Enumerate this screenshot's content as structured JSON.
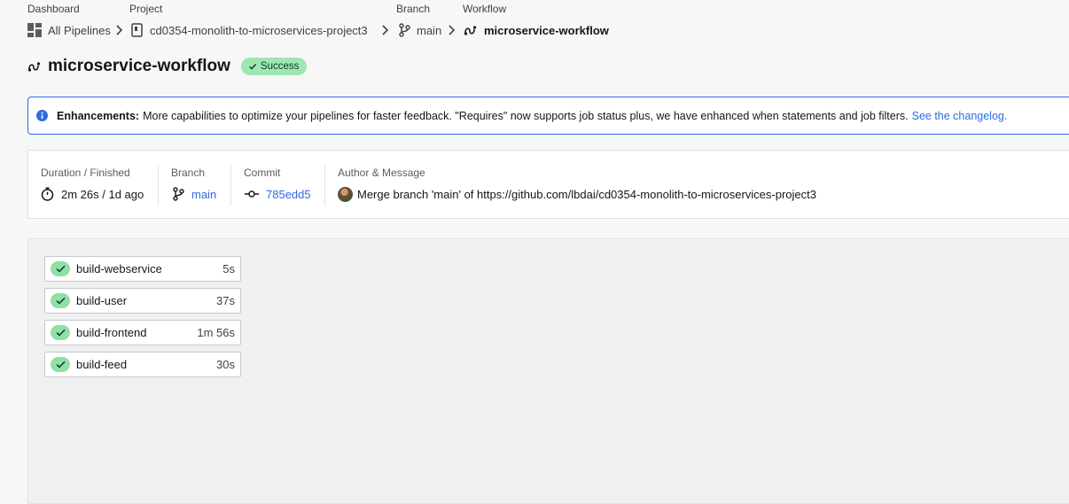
{
  "breadcrumb": {
    "dashboard": {
      "label": "Dashboard",
      "value": "All Pipelines",
      "icon": "grid-icon"
    },
    "project": {
      "label": "Project",
      "value": "cd0354-monolith-to-microservices-project3",
      "icon": "repo-icon"
    },
    "branch": {
      "label": "Branch",
      "value": "main",
      "icon": "branch-icon"
    },
    "workflow": {
      "label": "Workflow",
      "value": "microservice-workflow",
      "icon": "workflow-icon"
    }
  },
  "header": {
    "title": "microservice-workflow",
    "status": "Success",
    "status_color": "#9ee6b3"
  },
  "banner": {
    "title": "Enhancements:",
    "text": "More capabilities to optimize your pipelines for faster feedback. \"Requires\" now supports job status plus, we have enhanced when statements and job filters.",
    "link": "See the changelog.",
    "accent": "#2e6be6"
  },
  "info": {
    "duration": {
      "label": "Duration / Finished",
      "value": "2m 26s / 1d ago",
      "icon": "stopwatch-icon"
    },
    "branch": {
      "label": "Branch",
      "value": "main",
      "icon": "branch-icon"
    },
    "commit": {
      "label": "Commit",
      "value": "785edd5",
      "icon": "commit-icon"
    },
    "author": {
      "label": "Author & Message",
      "message": "Merge branch 'main' of https://github.com/lbdai/cd0354-monolith-to-microservices-project3"
    }
  },
  "jobs": [
    {
      "name": "build-webservice",
      "duration": "5s",
      "status": "success"
    },
    {
      "name": "build-user",
      "duration": "37s",
      "status": "success"
    },
    {
      "name": "build-frontend",
      "duration": "1m 56s",
      "status": "success"
    },
    {
      "name": "build-feed",
      "duration": "30s",
      "status": "success"
    }
  ]
}
